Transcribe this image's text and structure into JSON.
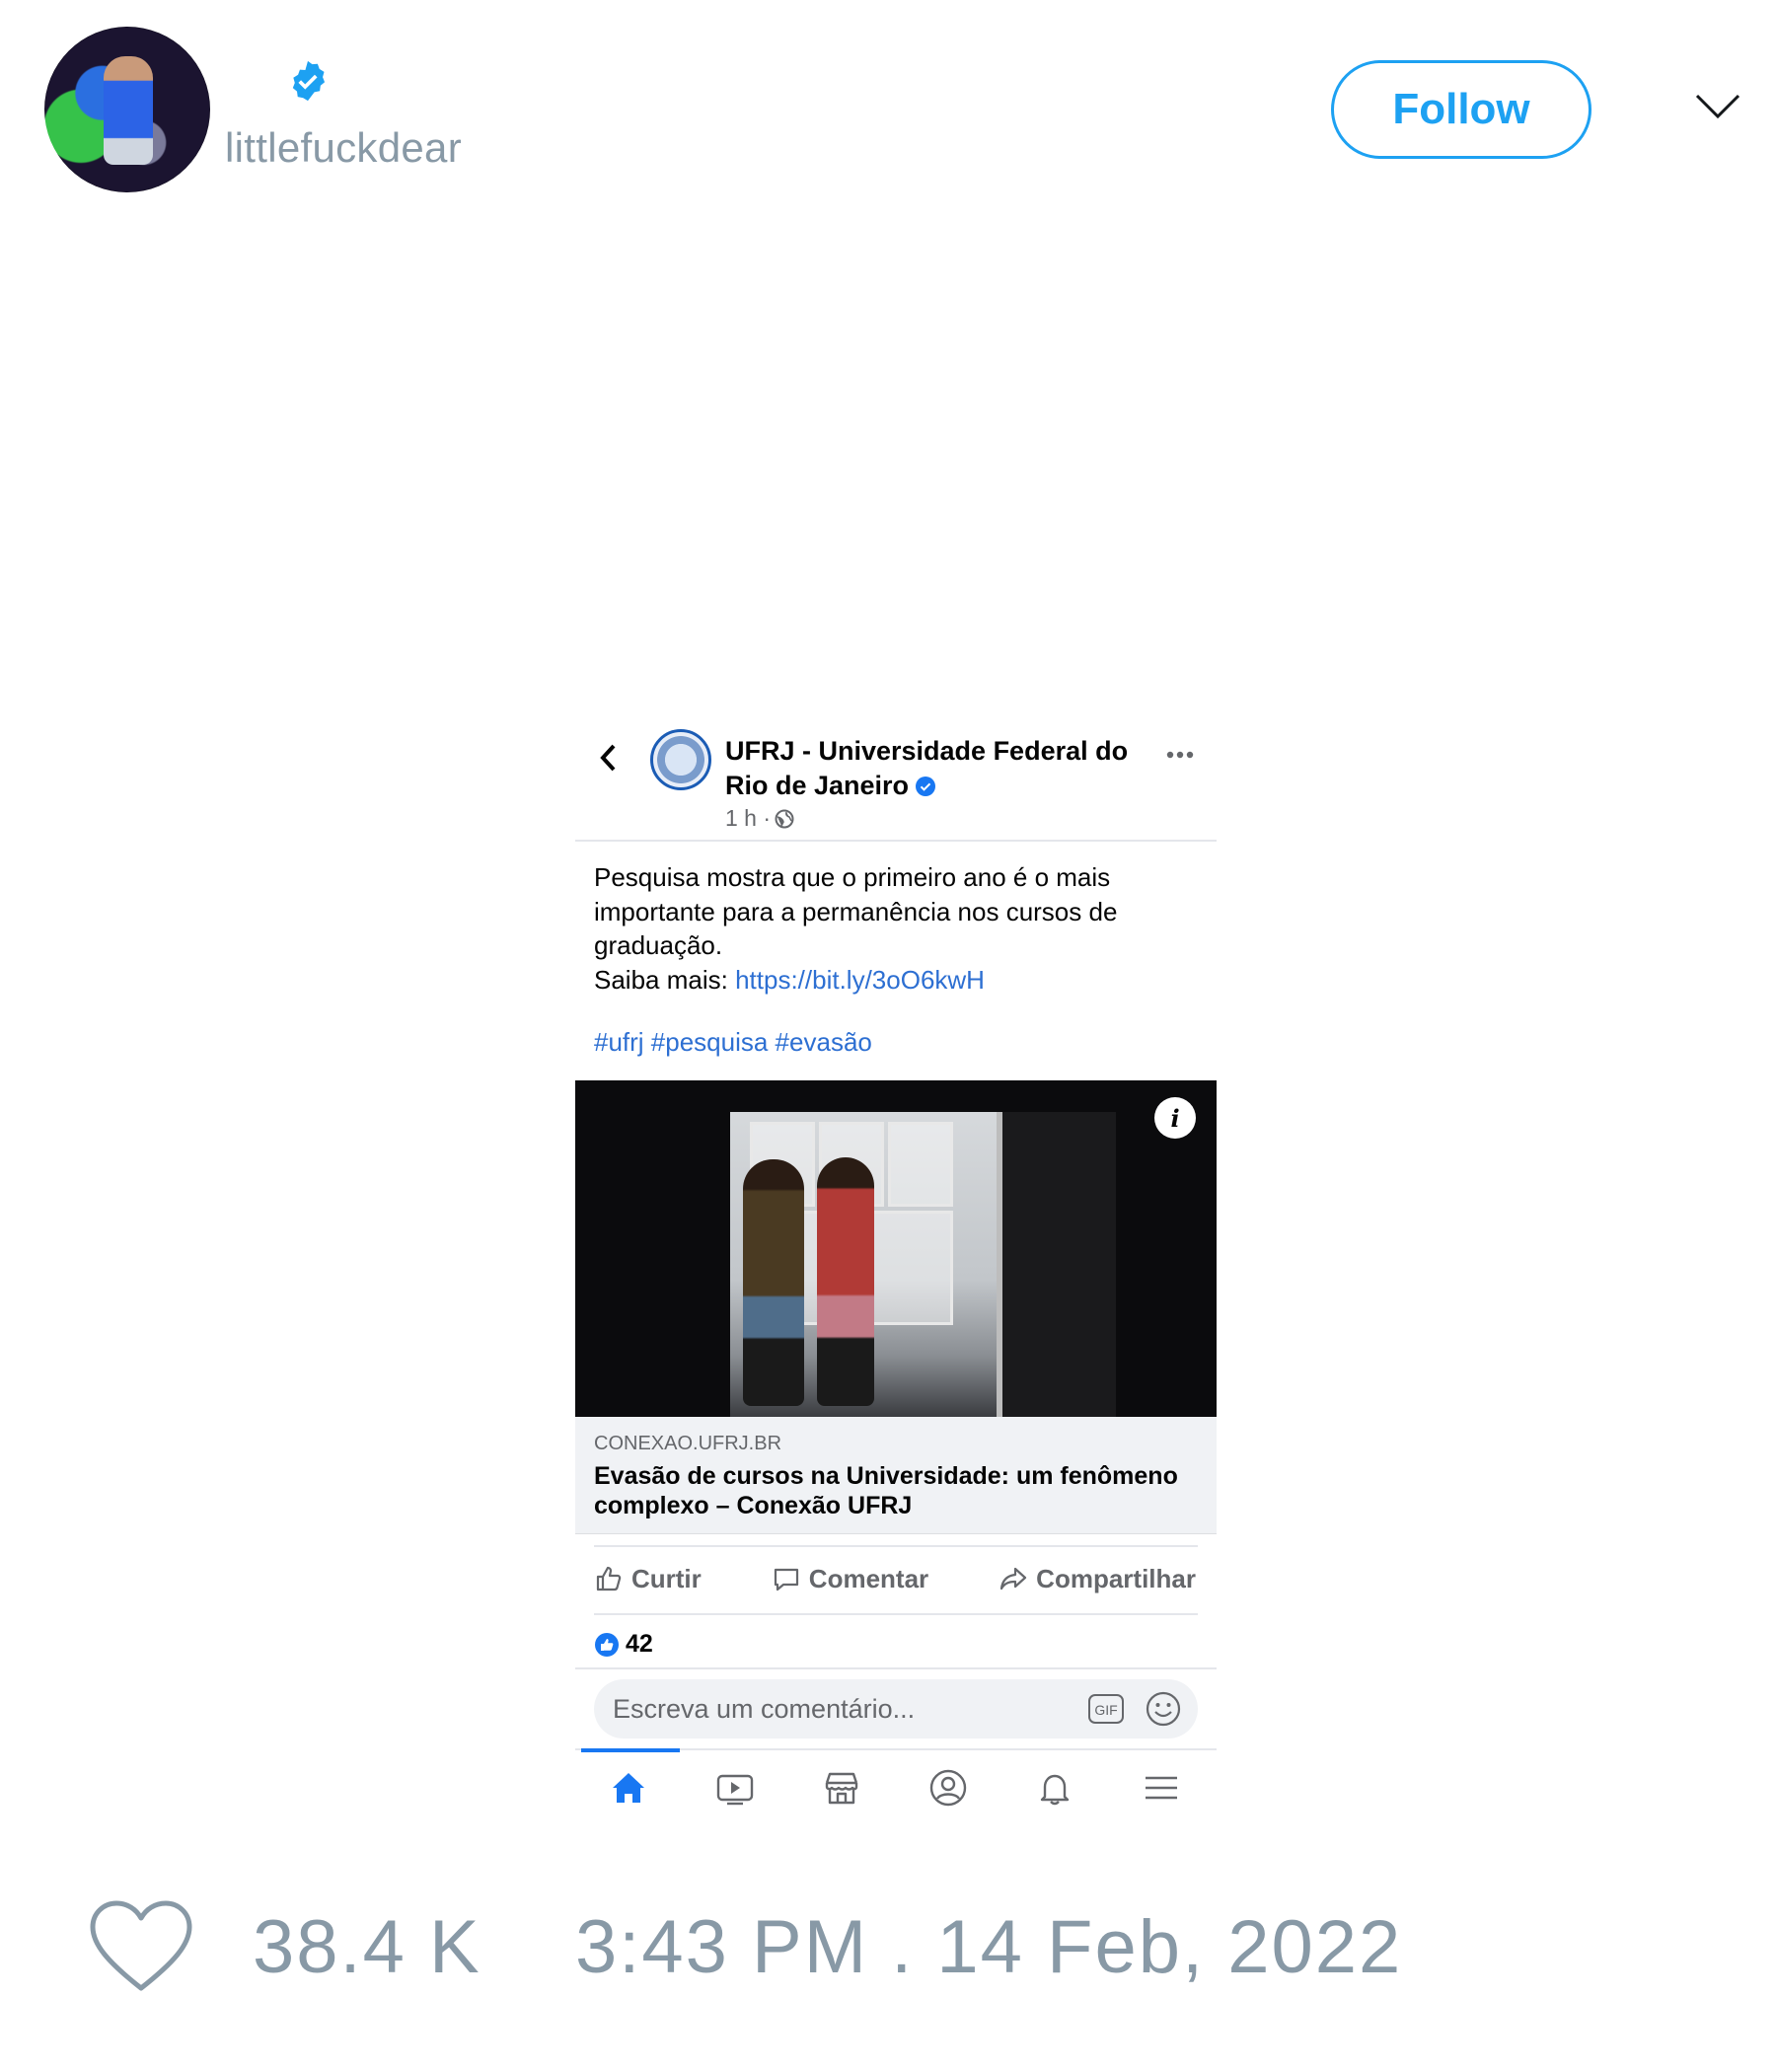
{
  "tweet": {
    "handle": "littlefuckdear",
    "follow_label": "Follow",
    "like_count": "38.4 K",
    "timestamp": "3:43 PM . 14 Feb, 2022",
    "accent_color": "#1da1f2",
    "muted_color": "#8899a6"
  },
  "fb_post": {
    "page_name": "UFRJ - Universidade Federal do Rio de Janeiro",
    "time": "1 h ·",
    "text_lines": [
      "Pesquisa mostra que o primeiro ano é o mais",
      "importante para a permanência nos cursos de",
      "graduação."
    ],
    "saiba_label": "Saiba mais: ",
    "link": "https://bit.ly/3oO6kwH",
    "hashtags": "#ufrj #pesquisa #evasão",
    "link_domain": "CONEXAO.UFRJ.BR",
    "link_title": "Evasão de cursos na Universidade: um fenômeno complexo – Conexão UFRJ",
    "actions": {
      "like": "Curtir",
      "comment": "Comentar",
      "share": "Compartilhar"
    },
    "reaction_count": "42",
    "comment_placeholder": "Escreva um comentário...",
    "link_color": "#2d6fd2"
  },
  "icons": {
    "tabbar": [
      "home-icon",
      "watch-icon",
      "marketplace-icon",
      "profile-icon",
      "notifications-icon",
      "menu-icon"
    ]
  }
}
